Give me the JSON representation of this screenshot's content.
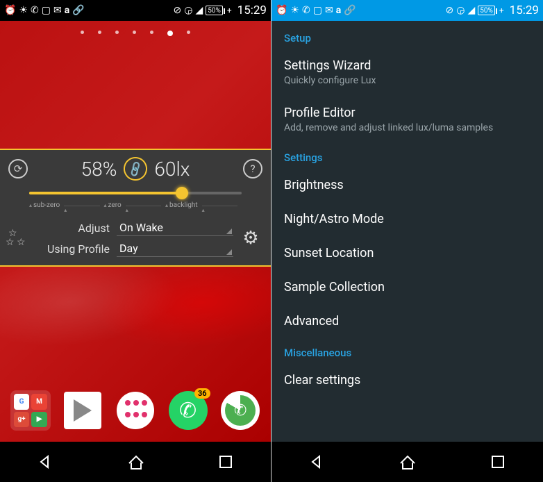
{
  "status": {
    "battery": "50%",
    "time": "15:29"
  },
  "left": {
    "wallpaper_pages": 7,
    "active_page_index": 5,
    "lux": {
      "brightness_pct": "58%",
      "lux_value": "60lx",
      "slider_pct": 72,
      "tick_labels": [
        "sub-zero",
        "zero",
        "backlight"
      ],
      "adjust_label": "Adjust",
      "adjust_value": "On Wake",
      "profile_label": "Using Profile",
      "profile_value": "Day"
    },
    "dock": {
      "whatsapp_badge": "36"
    }
  },
  "right": {
    "sections": [
      {
        "header": "Setup",
        "items": [
          {
            "title": "Settings Wizard",
            "sub": "Quickly configure Lux"
          },
          {
            "title": "Profile Editor",
            "sub": "Add, remove and adjust linked lux/luma samples"
          }
        ]
      },
      {
        "header": "Settings",
        "items": [
          {
            "title": "Brightness"
          },
          {
            "title": "Night/Astro Mode"
          },
          {
            "title": "Sunset Location"
          },
          {
            "title": "Sample Collection"
          },
          {
            "title": "Advanced"
          }
        ]
      },
      {
        "header": "Miscellaneous",
        "items": [
          {
            "title": "Clear settings"
          }
        ]
      }
    ]
  }
}
